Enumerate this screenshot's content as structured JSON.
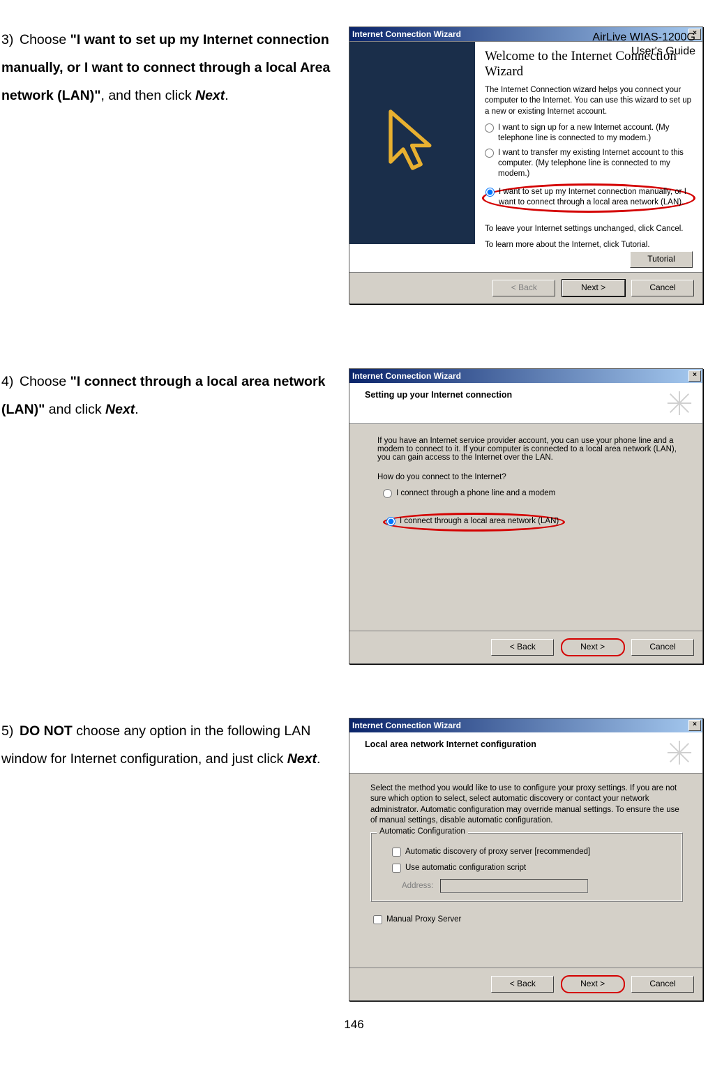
{
  "header": {
    "line1": "AirLive WIAS-1200G",
    "line2": "User's Guide"
  },
  "steps": {
    "s3": {
      "num": "3)",
      "pre": "Choose ",
      "bold": "\"I want to set up my Internet connection manually, or I want to connect through a local Area network (LAN)\"",
      "mid": ", and then click ",
      "btn": "Next",
      "post": "."
    },
    "s4": {
      "num": "4)",
      "pre": "Choose ",
      "bold": "\"I connect through a local area network (LAN)\"",
      "mid": " and click ",
      "btn": "Next",
      "post": "."
    },
    "s5": {
      "num": "5)",
      "bold": "DO NOT",
      "mid1": " choose any option in the following LAN window for Internet configuration, and just click ",
      "btn": "Next",
      "post": "."
    }
  },
  "dlg1": {
    "title": "Internet Connection Wizard",
    "heading": "Welcome to the Internet Connection Wizard",
    "intro": "The Internet Connection wizard helps you connect your computer to the Internet. You can use this wizard to set up a new or existing Internet account.",
    "opt1": "I want to sign up for a new Internet account. (My telephone line is connected to my modem.)",
    "opt2": "I want to transfer my existing Internet account to this computer. (My telephone line is connected to my modem.)",
    "opt3": "I want to set up my Internet connection manually, or I want to connect through a local area network (LAN).",
    "leave": "To leave your Internet settings unchanged, click Cancel.",
    "learn": "To learn more about the Internet, click Tutorial.",
    "tutorial": "Tutorial",
    "back": "< Back",
    "next": "Next >",
    "cancel": "Cancel"
  },
  "dlg2": {
    "title": "Internet Connection Wizard",
    "heading": "Setting up your Internet connection",
    "intro": "If you have an Internet service provider account, you can use your phone line and a modem to connect to it. If your computer is connected to a local area network (LAN), you can gain access to the Internet over the LAN.",
    "question": "How do you connect to the Internet?",
    "opt1": "I connect through a phone line and a modem",
    "opt2": "I connect through a local area network (LAN)",
    "back": "< Back",
    "next": "Next >",
    "cancel": "Cancel"
  },
  "dlg3": {
    "title": "Internet Connection Wizard",
    "heading": "Local area network Internet configuration",
    "intro": "Select the method you would like to use to configure your proxy settings. If you are not sure which option to select, select automatic discovery or contact your network administrator. Automatic configuration may override manual settings. To ensure the use of manual settings, disable automatic configuration.",
    "group": "Automatic Configuration",
    "chk1": "Automatic discovery of proxy server [recommended]",
    "chk2": "Use automatic configuration script",
    "addr": "Address:",
    "manual": "Manual Proxy Server",
    "back": "< Back",
    "next": "Next >",
    "cancel": "Cancel"
  },
  "pagenum": "146"
}
